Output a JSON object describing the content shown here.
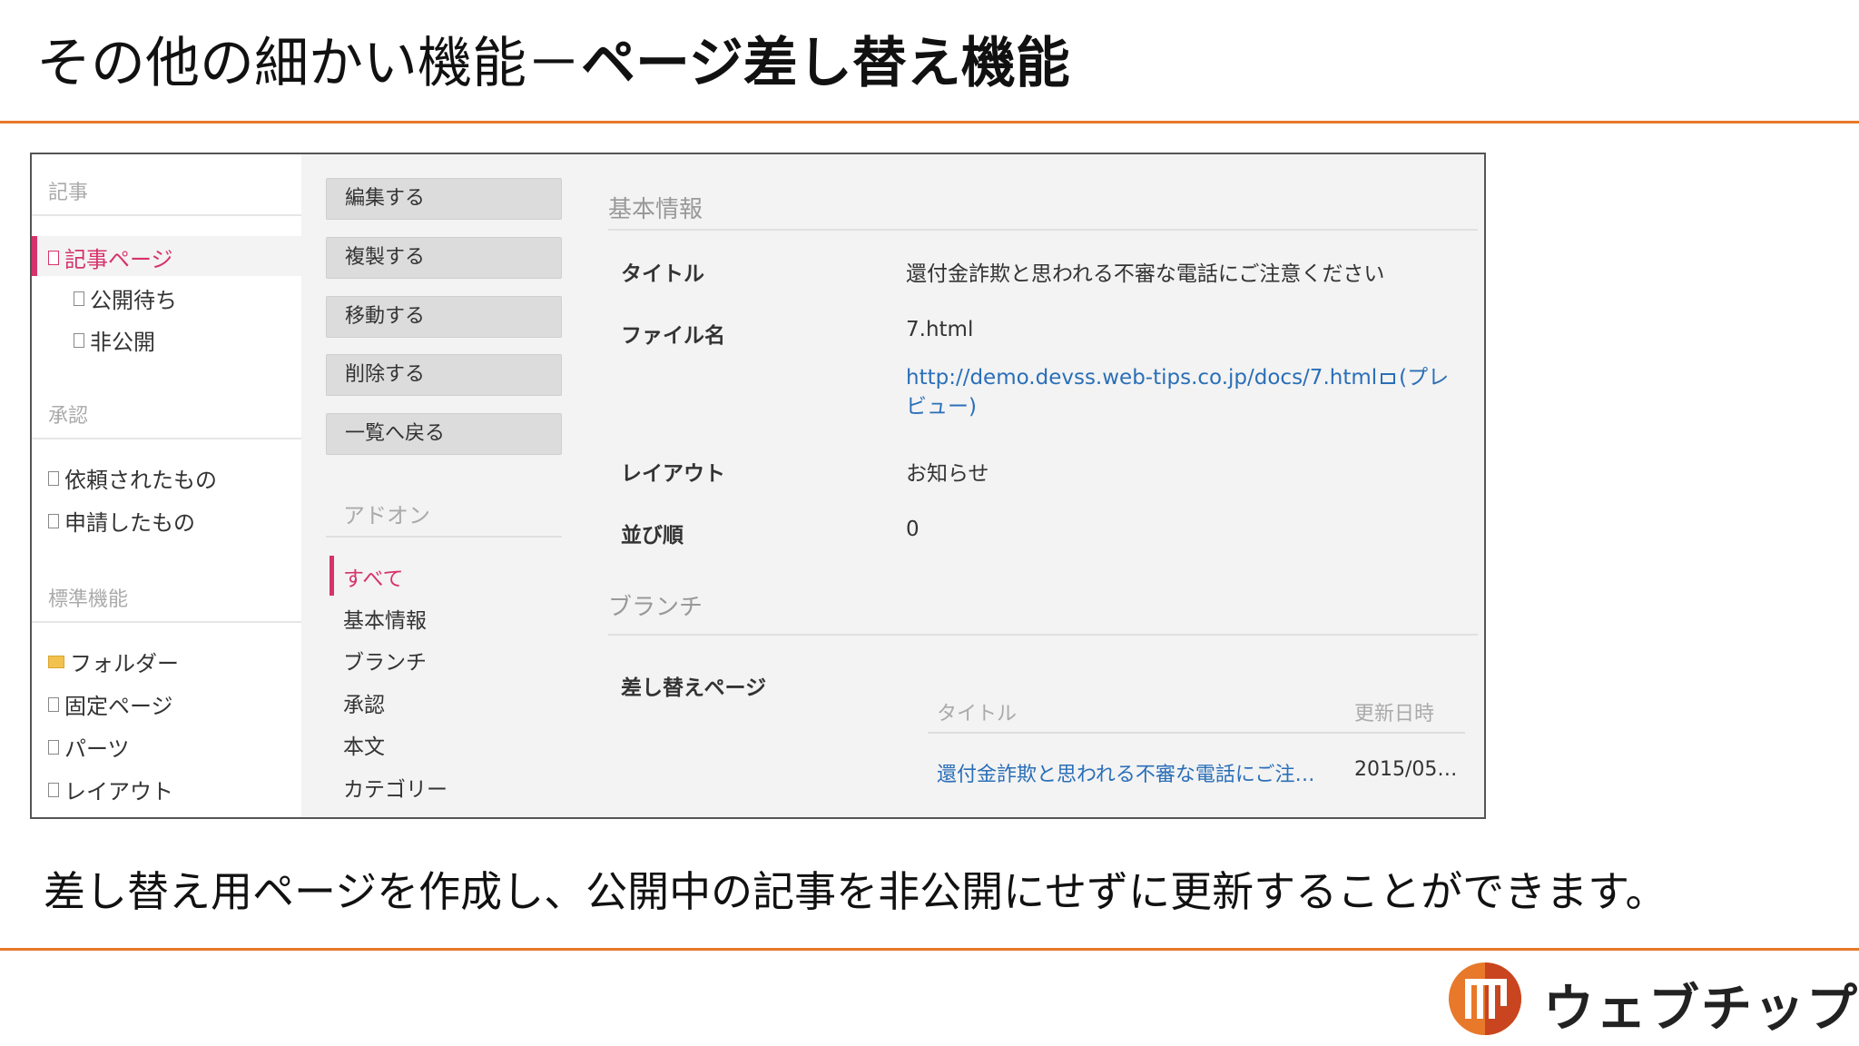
{
  "slide": {
    "title_regular": "その他の細かい機能－",
    "title_bold": "ページ差し替え機能",
    "caption": "差し替え用ページを作成し、公開中の記事を非公開にせずに更新することができます。",
    "logo_text": "ウェブチップス",
    "accent_color": "#e8782a"
  },
  "sidebar": {
    "sections": [
      {
        "heading": "記事",
        "items": [
          {
            "label": "記事ページ",
            "icon": "document-icon",
            "active": true
          },
          {
            "label": "公開待ち",
            "icon": "document-icon"
          },
          {
            "label": "非公開",
            "icon": "document-icon"
          }
        ]
      },
      {
        "heading": "承認",
        "items": [
          {
            "label": "依頼されたもの",
            "icon": "document-icon"
          },
          {
            "label": "申請したもの",
            "icon": "document-icon"
          }
        ]
      },
      {
        "heading": "標準機能",
        "items": [
          {
            "label": "フォルダー",
            "icon": "folder-icon"
          },
          {
            "label": "固定ページ",
            "icon": "document-icon"
          },
          {
            "label": "パーツ",
            "icon": "document-icon"
          },
          {
            "label": "レイアウト",
            "icon": "document-icon"
          }
        ]
      }
    ]
  },
  "actions": {
    "buttons": [
      "編集する",
      "複製する",
      "移動する",
      "削除する",
      "一覧へ戻る"
    ],
    "addon_heading": "アドオン",
    "addons": [
      "すべて",
      "基本情報",
      "ブランチ",
      "承認",
      "本文",
      "カテゴリー"
    ]
  },
  "info": {
    "heading": "基本情報",
    "title_label": "タイトル",
    "title_value": "還付金詐欺と思われる不審な電話にご注意ください",
    "filename_label": "ファイル名",
    "filename_value": "7.html",
    "url": "http://demo.devss.web-tips.co.jp/docs/7.html",
    "preview_line1": "(プレ",
    "preview_line2": "ビュー)",
    "layout_label": "レイアウト",
    "layout_value": "お知らせ",
    "order_label": "並び順",
    "order_value": "0"
  },
  "branch": {
    "heading": "ブランチ",
    "replace_label": "差し替えページ",
    "col_title": "タイトル",
    "col_updated": "更新日時",
    "row_title": "還付金詐欺と思われる不審な電話にご注…",
    "row_updated": "2015/05…"
  }
}
